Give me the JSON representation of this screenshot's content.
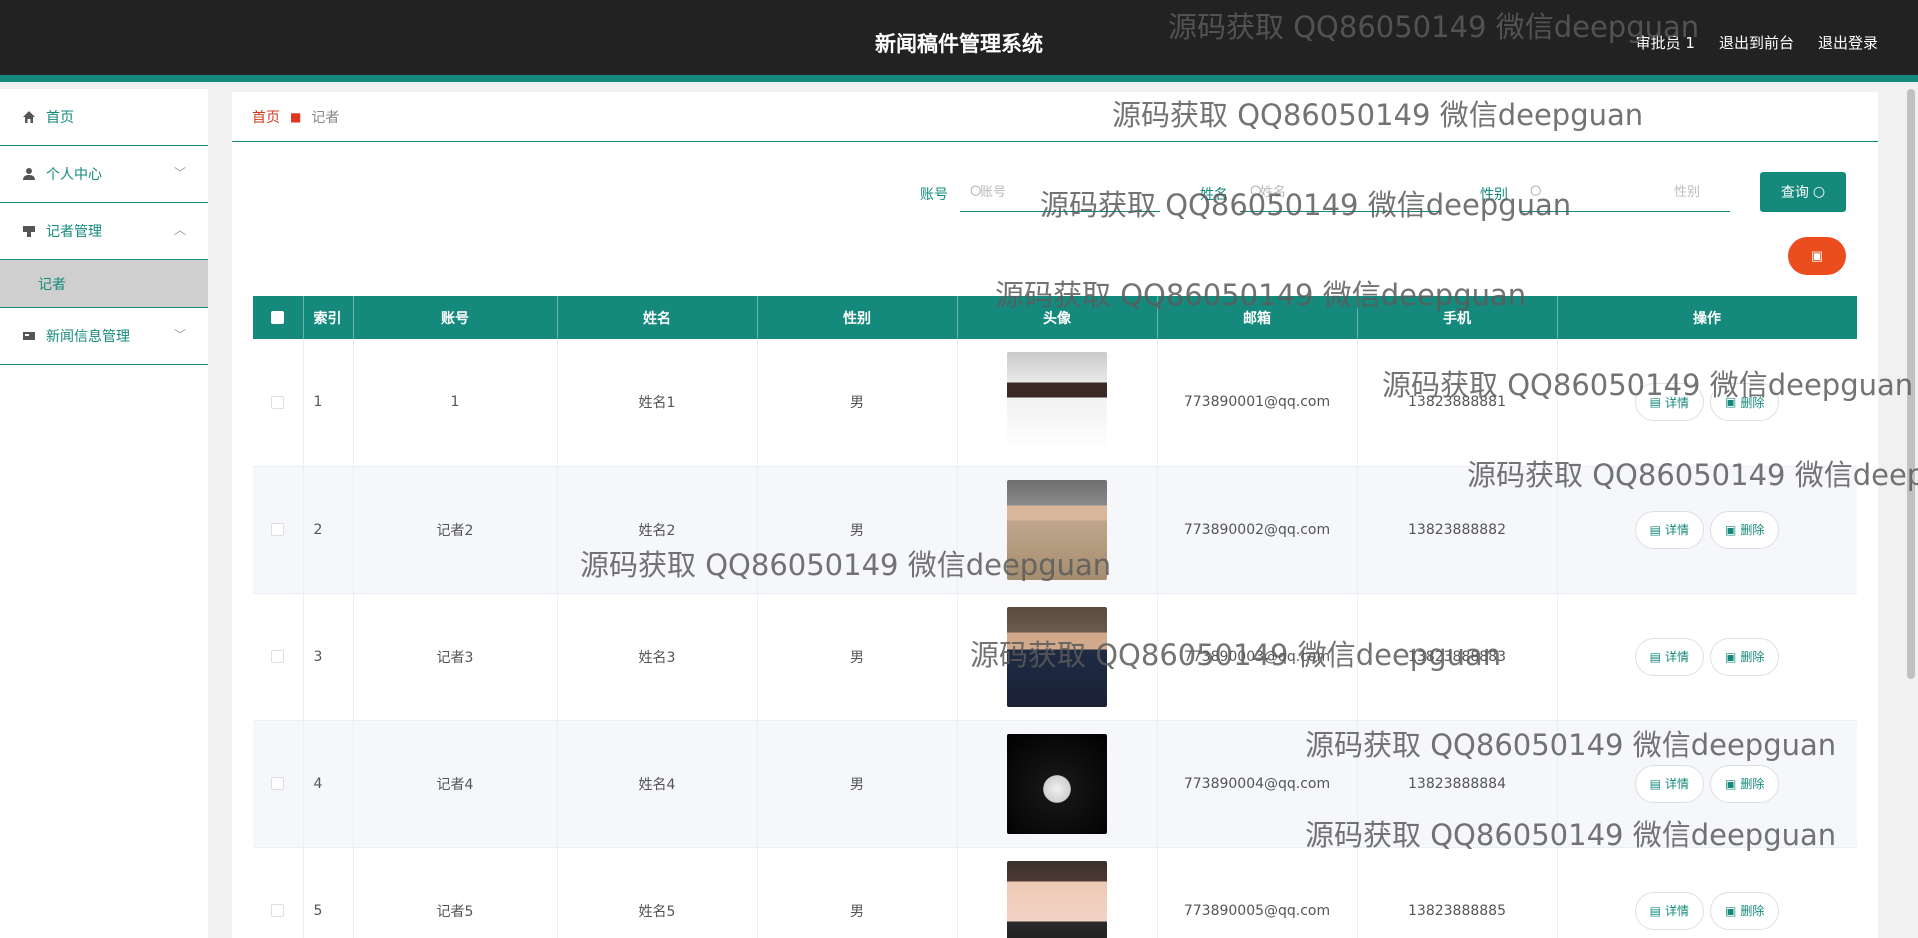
{
  "header": {
    "title": "新闻稿件管理系统",
    "user": "审批员 1",
    "front": "退出到前台",
    "logout": "退出登录"
  },
  "sidebar": {
    "items": [
      {
        "label": "首页",
        "icon": "home-icon"
      },
      {
        "label": "个人中心",
        "icon": "user-icon"
      },
      {
        "label": "记者管理",
        "icon": "reporter-icon"
      },
      {
        "label": "新闻信息管理",
        "icon": "news-icon"
      }
    ],
    "sub_label": "记者"
  },
  "breadcrumb": {
    "home": "首页",
    "current": "记者"
  },
  "search": {
    "account_label": "账号",
    "account_placeholder": "账号",
    "name_label": "姓名",
    "name_placeholder": "姓名",
    "gender_label": "性别",
    "gender_placeholder": "性别",
    "query_label": "查询"
  },
  "table": {
    "headers": {
      "index": "索引",
      "account": "账号",
      "name": "姓名",
      "gender": "性别",
      "avatar": "头像",
      "email": "邮箱",
      "phone": "手机",
      "ops": "操作"
    },
    "detail_label": "详情",
    "delete_label": "删除",
    "rows": [
      {
        "index": "1",
        "account": "1",
        "name": "姓名1",
        "gender": "男",
        "email": "773890001@qq.com",
        "phone": "13823888881"
      },
      {
        "index": "2",
        "account": "记者2",
        "name": "姓名2",
        "gender": "男",
        "email": "773890002@qq.com",
        "phone": "13823888882"
      },
      {
        "index": "3",
        "account": "记者3",
        "name": "姓名3",
        "gender": "男",
        "email": "773890003@qq.com",
        "phone": "13823888883"
      },
      {
        "index": "4",
        "account": "记者4",
        "name": "姓名4",
        "gender": "男",
        "email": "773890004@qq.com",
        "phone": "13823888884"
      },
      {
        "index": "5",
        "account": "记者5",
        "name": "姓名5",
        "gender": "男",
        "email": "773890005@qq.com",
        "phone": "13823888885"
      }
    ]
  },
  "colors": {
    "primary": "#158a7c",
    "danger": "#ec4d1e",
    "header_bg": "#222222"
  },
  "watermark": "源码获取 QQ86050149 微信deepguan"
}
